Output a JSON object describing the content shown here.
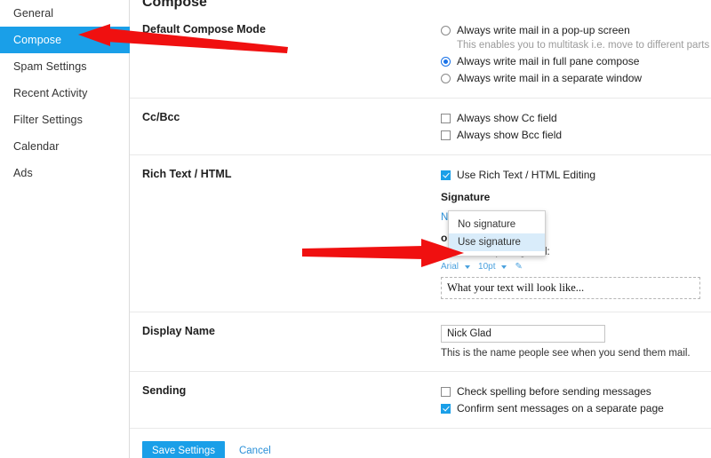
{
  "sidebar": {
    "items": [
      {
        "label": "General",
        "active": false
      },
      {
        "label": "Compose",
        "active": true
      },
      {
        "label": "Spam Settings",
        "active": false
      },
      {
        "label": "Recent Activity",
        "active": false
      },
      {
        "label": "Filter Settings",
        "active": false
      },
      {
        "label": "Calendar",
        "active": false
      },
      {
        "label": "Ads",
        "active": false
      }
    ]
  },
  "page": {
    "title": "Compose"
  },
  "compose_mode": {
    "label": "Default Compose Mode",
    "options": [
      {
        "label": "Always write mail in a pop-up screen",
        "selected": false
      },
      {
        "label": "Always write mail in full pane compose",
        "selected": true
      },
      {
        "label": "Always write mail in a separate window",
        "selected": false
      }
    ],
    "help": "This enables you to multitask i.e. move to different parts o"
  },
  "ccbcc": {
    "label": "Cc/Bcc",
    "options": [
      {
        "label": "Always show Cc field",
        "checked": false
      },
      {
        "label": "Always show Bcc field",
        "checked": false
      }
    ]
  },
  "rich_text": {
    "label": "Rich Text / HTML",
    "toggle": {
      "label": "Use Rich Text / HTML Editing",
      "checked": true
    },
    "signature": {
      "title": "Signature",
      "selected": "No signature",
      "dropdown_open": true,
      "options": [
        {
          "label": "No signature",
          "hovered": false
        },
        {
          "label": "Use signature",
          "hovered": true
        }
      ]
    },
    "font_editor": {
      "title_visible": "or",
      "help_visible": "s when composing mail:",
      "toolbar": {
        "font_family": "Arial",
        "font_size": "10pt",
        "format_icon": "text-color-icon"
      },
      "preview_text": "What your text will look like..."
    }
  },
  "display_name": {
    "label": "Display Name",
    "value": "Nick Glad",
    "placeholder": "",
    "help": "This is the name people see when you send them mail."
  },
  "sending": {
    "label": "Sending",
    "options": [
      {
        "label": "Check spelling before sending messages",
        "checked": false
      },
      {
        "label": "Confirm sent messages on a separate page",
        "checked": true
      }
    ]
  },
  "footer": {
    "save_label": "Save Settings",
    "cancel_label": "Cancel"
  },
  "annotations": {
    "arrow_color": "#f01010",
    "arrow_compose": "points-left-at-compose-nav-item",
    "arrow_signature": "points-right-at-use-signature-option"
  },
  "colors": {
    "accent_blue": "#1a9fe8",
    "link_blue": "#2a90d8",
    "radio_blue": "#1a73e8",
    "hover_blue": "#d9ecfa"
  }
}
